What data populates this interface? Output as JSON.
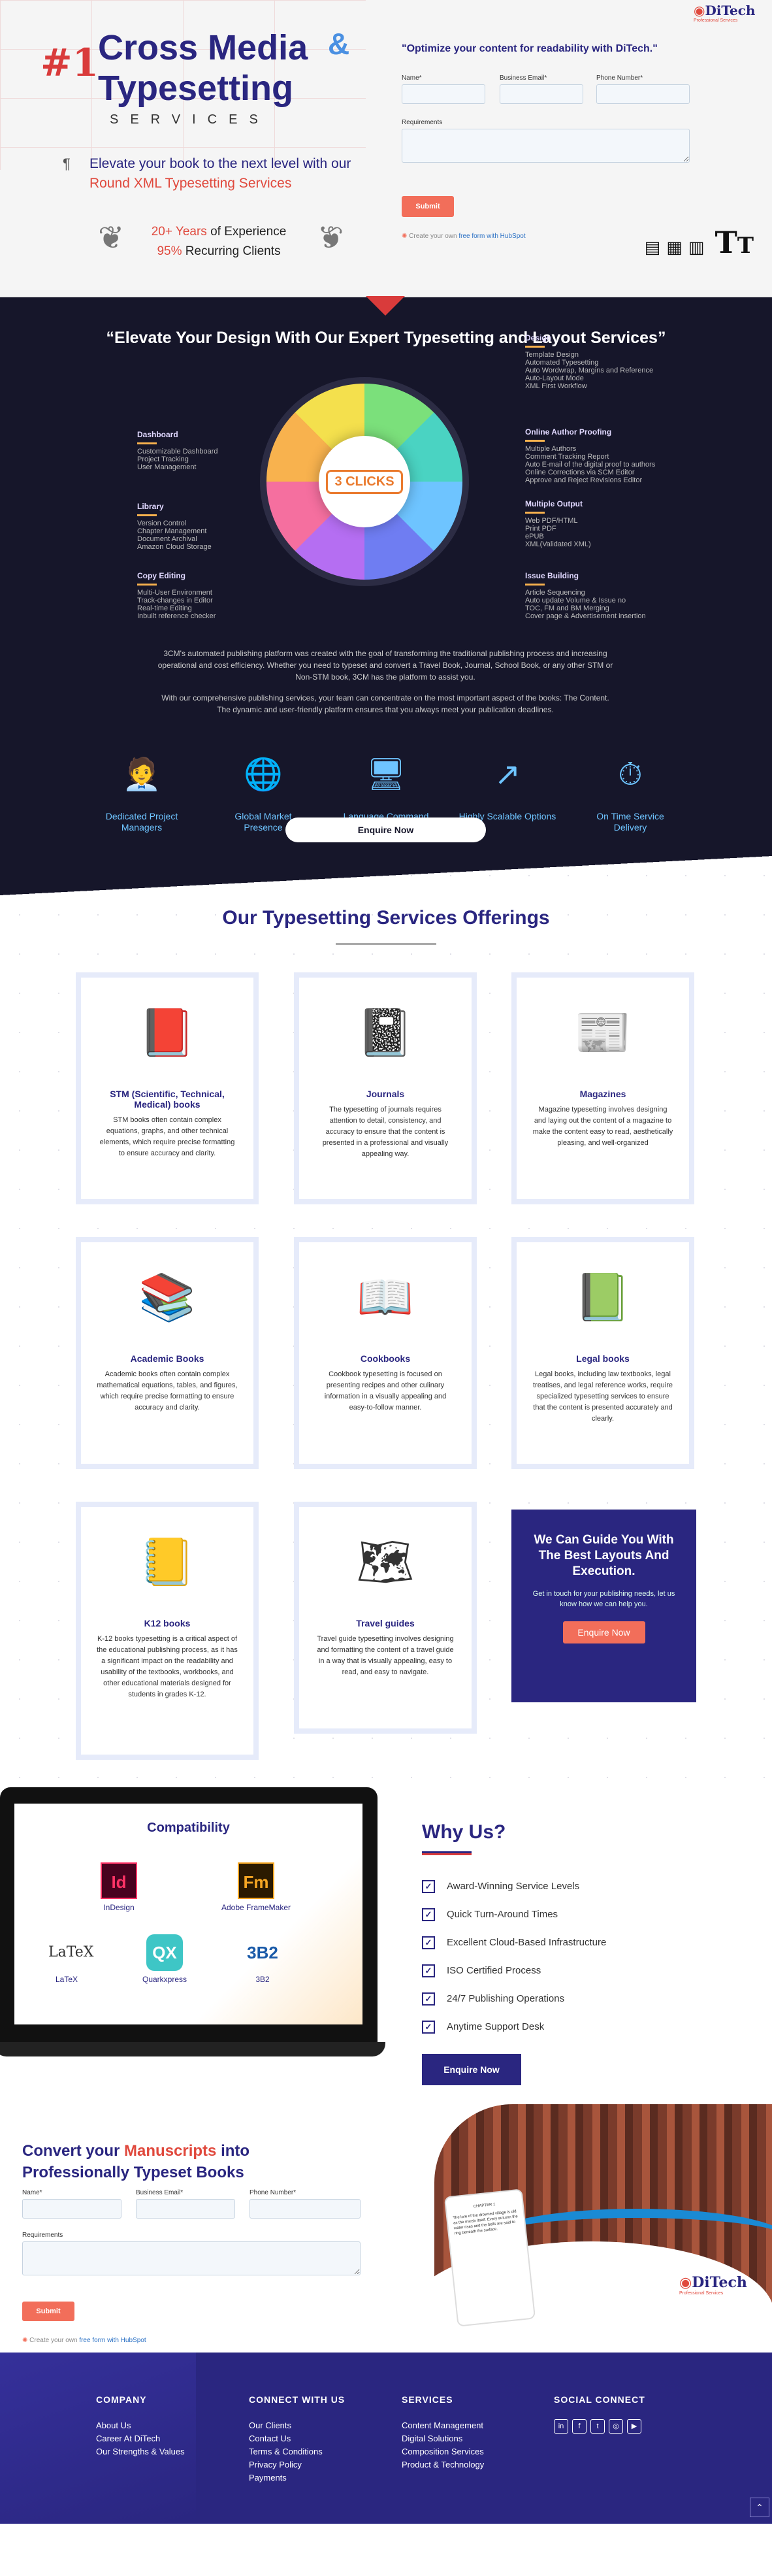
{
  "hero": {
    "number": "#1",
    "title_line1": "Cross Media",
    "amp": "&",
    "title_line2": "Typesetting",
    "services_word": "SERVICES",
    "pilcrow": "¶",
    "subtitle_pre": "Elevate your book to the next level with our ",
    "subtitle_red": "Round XML Typesetting Services",
    "exp_num": "20+ Years",
    "exp_text": " of Experience",
    "rec_num": "95%",
    "rec_text": " Recurring Clients",
    "form_title": "\"Optimize your content for readability with DiTech.\"",
    "label_name": "Name*",
    "label_email": "Business Email*",
    "label_phone": "Phone Number*",
    "label_req": "Requirements",
    "submit": "Submit",
    "hubspot_pre": "Create your own ",
    "hubspot_link": "free form with HubSpot"
  },
  "logo": {
    "text": "DiTech",
    "tag": "Professional Services"
  },
  "dark": {
    "heading": "“Elevate Your Design With Our Expert Typesetting and Layout Services”",
    "center_logo": "3 CLICKS",
    "wheel_labels": {
      "design": {
        "title": "Design",
        "items": [
          "Template Design",
          "Automated Typesetting",
          "Auto Wordwrap, Margins and Reference",
          "Auto-Layout Mode",
          "XML First Workflow"
        ]
      },
      "online": {
        "title": "Online Author Proofing",
        "items": [
          "Multiple Authors",
          "Comment Tracking Report",
          "Auto E-mail of the digital proof to authors",
          "Online Corrections via SCM Editor",
          "Approve and Reject Revisions Editor"
        ]
      },
      "output": {
        "title": "Multiple Output",
        "items": [
          "Web PDF/HTML",
          "Print PDF",
          "ePUB",
          "XML(Validated XML)"
        ]
      },
      "issue": {
        "title": "Issue Building",
        "items": [
          "Article Sequencing",
          "Auto update Volume & Issue no",
          "TOC, FM and BM Merging",
          "Cover page & Advertisement insertion"
        ]
      },
      "dashboard": {
        "title": "Dashboard",
        "items": [
          "Customizable Dashboard",
          "Project Tracking",
          "User Management"
        ]
      },
      "library": {
        "title": "Library",
        "items": [
          "Version Control",
          "Chapter Management",
          "Document Archival",
          "Amazon Cloud Storage"
        ]
      },
      "copy": {
        "title": "Copy Editing",
        "items": [
          "Multi-User Environment",
          "Track-changes in Editor",
          "Real-time Editing",
          "Inbuilt reference checker"
        ]
      }
    },
    "para1": "3CM's automated publishing platform was created with the goal of transforming the traditional publishing process and increasing operational and cost efficiency. Whether you need to typeset and convert a Travel Book, Journal, School Book, or any other STM or Non-STM book, 3CM has the platform to assist you.",
    "para2": "With our comprehensive publishing services, your team can concentrate on the most important aspect of the books: The Content. The dynamic and user-friendly platform ensures that you always meet your publication deadlines.",
    "features": [
      "Dedicated Project Managers",
      "Global Market Presence",
      "Language Command",
      "Highly Scalable Options",
      "On Time Service Delivery"
    ],
    "enquire": "Enquire Now"
  },
  "services": {
    "heading": "Our Typesetting Services Offerings",
    "cards": [
      {
        "title": "STM (Scientific, Technical, Medical) books",
        "text": "STM books often contain complex equations, graphs, and other technical elements, which require precise formatting to ensure accuracy and clarity."
      },
      {
        "title": "Journals",
        "text": "The typesetting of journals requires attention to detail, consistency, and accuracy to ensure that the content is presented in a professional and visually appealing way."
      },
      {
        "title": "Magazines",
        "text": "Magazine typesetting involves designing and laying out the content of a magazine to make the content easy to read, aesthetically pleasing, and well-organized"
      },
      {
        "title": "Academic Books",
        "text": "Academic books often contain complex mathematical equations, tables, and figures, which require precise formatting to ensure accuracy and clarity."
      },
      {
        "title": "Cookbooks",
        "text": "Cookbook typesetting is focused on presenting recipes and other culinary information in a visually appealing and easy-to-follow manner."
      },
      {
        "title": "Legal books",
        "text": "Legal books, including law textbooks, legal treatises, and legal reference works, require specialized typesetting services to ensure that the content is presented accurately and clearly."
      },
      {
        "title": "K12 books",
        "text": "K-12 books typesetting is a critical aspect of the educational publishing process, as it has a significant impact on the readability and usability of the textbooks, workbooks, and other educational materials designed for students in grades K-12."
      },
      {
        "title": "Travel guides",
        "text": "Travel guide typesetting involves designing and formatting the content of a travel guide in a way that is visually appealing, easy to read, and easy to navigate."
      }
    ],
    "guide_title": "We Can Guide You With The Best Layouts And Execution.",
    "guide_text": "Get in touch for your publishing needs, let us know how we can help you.",
    "guide_btn": "Enquire Now"
  },
  "why": {
    "compat_title": "Compatibility",
    "compat": [
      {
        "logo": "Id",
        "label": "InDesign"
      },
      {
        "logo": "Fm",
        "label": "Adobe FrameMaker"
      },
      {
        "logo": "LaTeX",
        "label": "LaTeX"
      },
      {
        "logo": "QX",
        "label": "Quarkxpress"
      },
      {
        "logo": "3B2",
        "label": "3B2"
      }
    ],
    "heading": "Why Us?",
    "items": [
      "Award-Winning Service Levels",
      "Quick Turn-Around Times",
      "Excellent Cloud-Based Infrastructure",
      "ISO Certified Process",
      "24/7 Publishing Operations",
      "Anytime Support Desk"
    ],
    "button": "Enquire Now"
  },
  "convert": {
    "h_pre": "Convert your ",
    "h_red": "Manuscripts",
    "h_post": " into",
    "h_line2": "Professionally Typeset Books",
    "phone_head": "CHAPTER 1",
    "phone_text": "The lore of the drowned village is old as the marsh itself. Every autumn the water rises and the bells are said to ring beneath the surface."
  },
  "footer": {
    "company_h": "COMPANY",
    "company": [
      "About Us",
      "Career At DiTech",
      "Our Strengths & Values"
    ],
    "connect_h": "CONNECT WITH US",
    "connect": [
      "Our Clients",
      "Contact Us",
      "Terms & Conditions",
      "Privacy Policy",
      "Payments"
    ],
    "services_h": "SERVICES",
    "services": [
      "Content Management",
      "Digital Solutions",
      "Composition Services",
      "Product & Technology"
    ],
    "social_h": "SOCIAL CONNECT",
    "social": [
      "in",
      "f",
      "t",
      "◎",
      "▶"
    ]
  },
  "colors": {
    "navy": "#2a2680",
    "red": "#e0493d",
    "dark": "#16162a"
  }
}
